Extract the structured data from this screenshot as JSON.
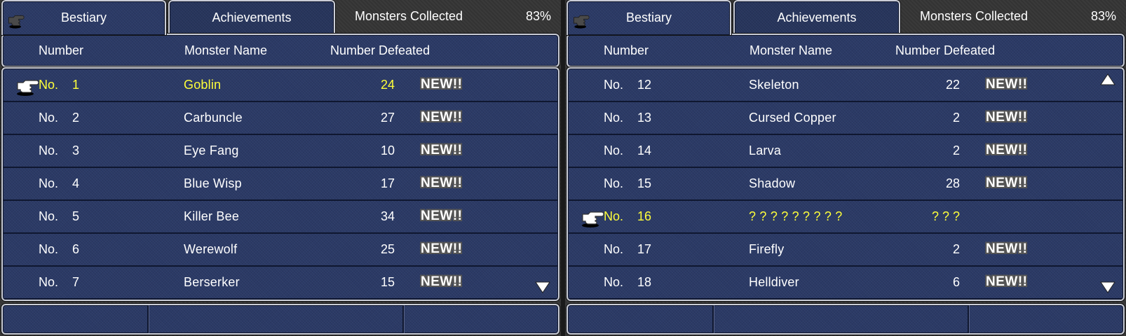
{
  "panels": [
    {
      "tabs": {
        "bestiary": "Bestiary",
        "achievements": "Achievements"
      },
      "collected": {
        "label": "Monsters Collected",
        "value": "83%"
      },
      "columns": {
        "number": "Number",
        "name": "Monster Name",
        "defeated": "Number Defeated"
      },
      "rows": [
        {
          "no": "No.",
          "num": "1",
          "name": "Goblin",
          "defeated": "24",
          "badge": "NEW!!",
          "selected": true
        },
        {
          "no": "No.",
          "num": "2",
          "name": "Carbuncle",
          "defeated": "27",
          "badge": "NEW!!",
          "selected": false
        },
        {
          "no": "No.",
          "num": "3",
          "name": "Eye Fang",
          "defeated": "10",
          "badge": "NEW!!",
          "selected": false
        },
        {
          "no": "No.",
          "num": "4",
          "name": "Blue Wisp",
          "defeated": "17",
          "badge": "NEW!!",
          "selected": false
        },
        {
          "no": "No.",
          "num": "5",
          "name": "Killer Bee",
          "defeated": "34",
          "badge": "NEW!!",
          "selected": false
        },
        {
          "no": "No.",
          "num": "6",
          "name": "Werewolf",
          "defeated": "25",
          "badge": "NEW!!",
          "selected": false
        },
        {
          "no": "No.",
          "num": "7",
          "name": "Berserker",
          "defeated": "15",
          "badge": "NEW!!",
          "selected": false
        }
      ],
      "scroll": {
        "up": false,
        "down": true
      }
    },
    {
      "tabs": {
        "bestiary": "Bestiary",
        "achievements": "Achievements"
      },
      "collected": {
        "label": "Monsters Collected",
        "value": "83%"
      },
      "columns": {
        "number": "Number",
        "name": "Monster Name",
        "defeated": "Number Defeated"
      },
      "rows": [
        {
          "no": "No.",
          "num": "12",
          "name": "Skeleton",
          "defeated": "22",
          "badge": "NEW!!",
          "selected": false
        },
        {
          "no": "No.",
          "num": "13",
          "name": "Cursed Copper",
          "defeated": "2",
          "badge": "NEW!!",
          "selected": false
        },
        {
          "no": "No.",
          "num": "14",
          "name": "Larva",
          "defeated": "2",
          "badge": "NEW!!",
          "selected": false
        },
        {
          "no": "No.",
          "num": "15",
          "name": "Shadow",
          "defeated": "28",
          "badge": "NEW!!",
          "selected": false
        },
        {
          "no": "No.",
          "num": "16",
          "name": "? ? ? ? ? ? ? ? ?",
          "defeated": "? ? ?",
          "badge": "",
          "selected": true
        },
        {
          "no": "No.",
          "num": "17",
          "name": "Firefly",
          "defeated": "2",
          "badge": "NEW!!",
          "selected": false
        },
        {
          "no": "No.",
          "num": "18",
          "name": "Helldiver",
          "defeated": "6",
          "badge": "NEW!!",
          "selected": false
        }
      ],
      "scroll": {
        "up": true,
        "down": true
      }
    }
  ],
  "colors": {
    "highlight": "#ffff3a",
    "panel": "#2b3a66",
    "border": "#c9ccd6"
  },
  "icons": {
    "cursor": "pointing-hand-icon",
    "scroll_up": "scroll-up-arrow-icon",
    "scroll_down": "scroll-down-arrow-icon"
  }
}
